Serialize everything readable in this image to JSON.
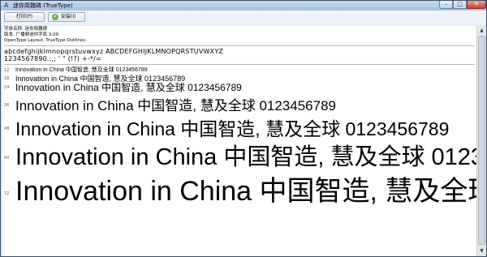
{
  "window": {
    "title": "迷你简魏碑 (TrueType)",
    "minimize_glyph": "–",
    "maximize_glyph": "□",
    "close_glyph": "✕"
  },
  "toolbar": {
    "print_label": "打印(P)",
    "install_label": "安装(I)",
    "install_icon_glyph": "✔"
  },
  "font_info": {
    "name_line": "字体名称: 迷你简魏碑",
    "version_line": "版本: 广播频迷你字库 3.00",
    "type_line": "OpenType Layout, TrueType Outlines"
  },
  "alphabet": {
    "lowercase": "abcdefghijklmnopqrstuvwxyz ABCDEFGHIJKLMNOPQRSTUVWXYZ",
    "numbers": "1234567890.:,; ' \" (!?) +-*/="
  },
  "sample_text": "Innovation in China 中国智造, 慧及全球 0123456789",
  "sizes": [
    {
      "label": "12"
    },
    {
      "label": "18"
    },
    {
      "label": "24"
    },
    {
      "label": "36"
    },
    {
      "label": "48"
    },
    {
      "label": "60"
    },
    {
      "label": "72"
    }
  ],
  "scrollbar": {
    "up_glyph": "▲",
    "down_glyph": "▼"
  }
}
